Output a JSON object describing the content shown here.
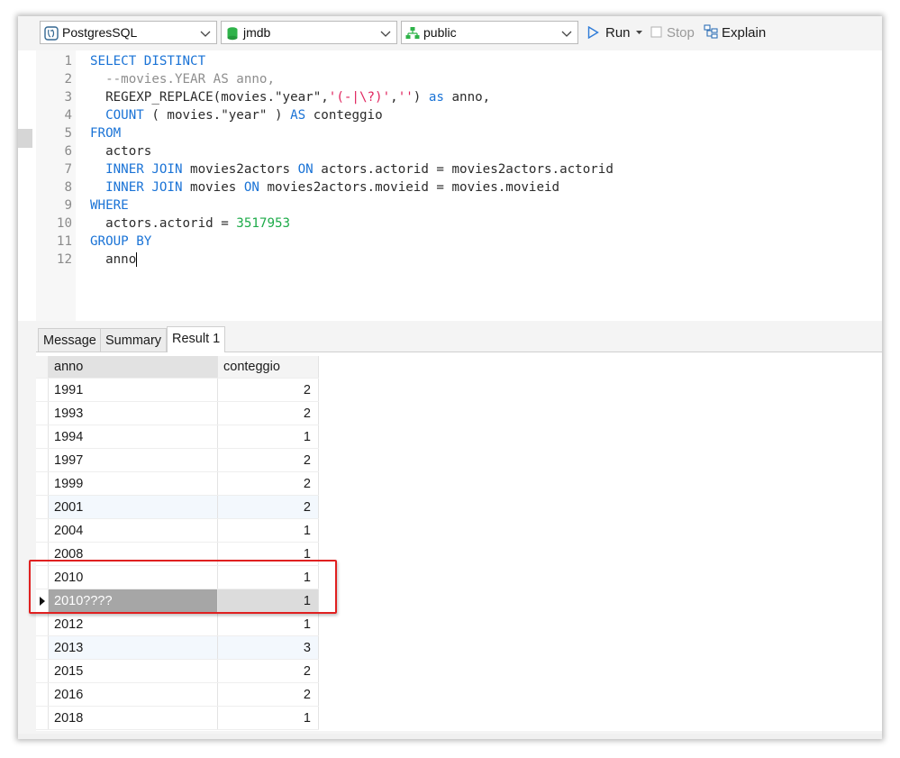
{
  "toolbar": {
    "connection": "PostgresSQL",
    "database": "jmdb",
    "schema": "public",
    "run": "Run",
    "stop": "Stop",
    "explain": "Explain"
  },
  "editor": {
    "lines": [
      {
        "n": "1"
      },
      {
        "n": "2"
      },
      {
        "n": "3"
      },
      {
        "n": "4"
      },
      {
        "n": "5"
      },
      {
        "n": "6"
      },
      {
        "n": "7"
      },
      {
        "n": "8"
      },
      {
        "n": "9"
      },
      {
        "n": "10"
      },
      {
        "n": "11"
      },
      {
        "n": "12"
      }
    ],
    "tokens": {
      "l1": "SELECT DISTINCT",
      "l2": "  --movies.YEAR AS anno,",
      "l3a": "  REGEXP_REPLACE(movies.\"year\",",
      "l3b": "'(-|\\?)'",
      "l3c": ",",
      "l3d": "''",
      "l3e": ") ",
      "l3f": "as",
      "l3g": " anno,",
      "l4a": "  ",
      "l4b": "COUNT",
      "l4c": " ( movies.\"year\" ) ",
      "l4d": "AS",
      "l4e": " conteggio",
      "l5": "FROM",
      "l6": "  actors",
      "l7a": "  ",
      "l7b": "INNER JOIN",
      "l7c": " movies2actors ",
      "l7d": "ON",
      "l7e": " actors.actorid = movies2actors.actorid",
      "l8a": "  ",
      "l8b": "INNER JOIN",
      "l8c": " movies ",
      "l8d": "ON",
      "l8e": " movies2actors.movieid = movies.movieid",
      "l9": "WHERE",
      "l10a": "  actors.actorid = ",
      "l10b": "3517953",
      "l11": "GROUP BY",
      "l12": "  anno"
    }
  },
  "tabs": [
    {
      "label": "Message"
    },
    {
      "label": "Summary"
    },
    {
      "label": "Result 1"
    }
  ],
  "results": {
    "columns": [
      "anno",
      "conteggio"
    ],
    "rows": [
      {
        "anno": "1991",
        "conteggio": "2"
      },
      {
        "anno": "1993",
        "conteggio": "2"
      },
      {
        "anno": "1994",
        "conteggio": "1"
      },
      {
        "anno": "1997",
        "conteggio": "2"
      },
      {
        "anno": "1999",
        "conteggio": "2"
      },
      {
        "anno": "2001",
        "conteggio": "2"
      },
      {
        "anno": "2004",
        "conteggio": "1"
      },
      {
        "anno": "2008",
        "conteggio": "1"
      },
      {
        "anno": "2010",
        "conteggio": "1"
      },
      {
        "anno": "2010????",
        "conteggio": "1"
      },
      {
        "anno": "2012",
        "conteggio": "1"
      },
      {
        "anno": "2013",
        "conteggio": "3"
      },
      {
        "anno": "2015",
        "conteggio": "2"
      },
      {
        "anno": "2016",
        "conteggio": "2"
      },
      {
        "anno": "2018",
        "conteggio": "1"
      }
    ]
  }
}
